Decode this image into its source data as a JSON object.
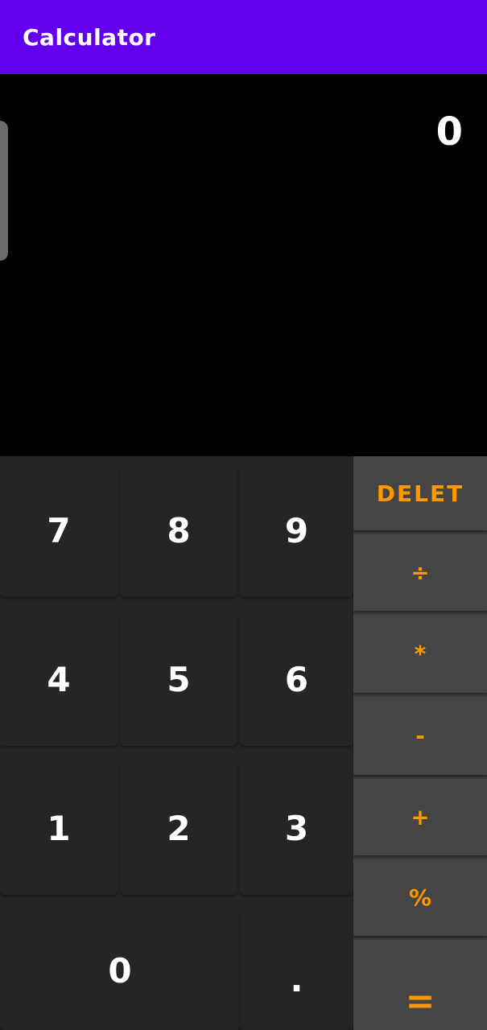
{
  "app_bar": {
    "title": "Calculator"
  },
  "display": {
    "value": "0"
  },
  "keypad": {
    "digits": [
      [
        "7",
        "8",
        "9"
      ],
      [
        "4",
        "5",
        "6"
      ],
      [
        "1",
        "2",
        "3"
      ]
    ],
    "zero": "0",
    "dot": ".",
    "operators": {
      "delete": "DELET",
      "divide": "÷",
      "multiply": "*",
      "subtract": "-",
      "add": "+",
      "percent": "%",
      "equals": "="
    }
  },
  "colors": {
    "app_bar": "#6200EE",
    "accent": "#FF9800",
    "display_bg": "#000000",
    "keypad_bg": "#262526",
    "operator_bg": "#454545"
  }
}
